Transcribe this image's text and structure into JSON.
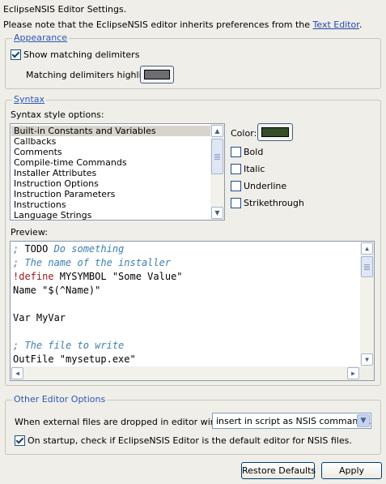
{
  "header": {
    "title": "EclipseNSIS Editor Settings.",
    "note_prefix": "Please note that the EclipseNSIS editor inherits preferences from the ",
    "note_link": "Text Editor",
    "note_suffix": "."
  },
  "appearance": {
    "title": "Appearance",
    "show_matching_delimiters": {
      "label": "Show matching delimiters",
      "checked": true
    },
    "highlight_label": "Matching delimiters highlight",
    "highlight_color": "#6d6e72"
  },
  "syntax": {
    "title": "Syntax",
    "options_label": "Syntax style options:",
    "items": [
      "Built-in Constants and Variables",
      "Callbacks",
      "Comments",
      "Compile-time Commands",
      "Installer Attributes",
      "Instruction Options",
      "Instruction Parameters",
      "Instructions",
      "Language Strings"
    ],
    "selected_index": 0,
    "color_label": "Color:",
    "color_value": "#344d2b",
    "bold": "Bold",
    "italic": "Italic",
    "underline": "Underline",
    "strikethrough": "Strikethrough",
    "preview_label": "Preview:"
  },
  "preview": {
    "l1a": "; ",
    "l1b": "TODO",
    "l1c": " Do something",
    "l2": "; The name of the installer",
    "l3a": "!define",
    "l3b": " MYSYMBOL \"Some Value\"",
    "l4": "Name \"$(^Name)\"",
    "l6": "Var MyVar",
    "l8": "; The file to write",
    "l9": "OutFile \"mysetup.exe\""
  },
  "other": {
    "title": "Other Editor Options",
    "drop_label": "When external files are dropped in editor window:",
    "drop_value": "insert in script as NSIS commands.",
    "startup_check": {
      "label": "On startup, check if EclipseNSIS Editor is the default editor for NSIS files.",
      "checked": true
    }
  },
  "buttons": {
    "restore": "Restore Defaults",
    "apply": "Apply"
  }
}
